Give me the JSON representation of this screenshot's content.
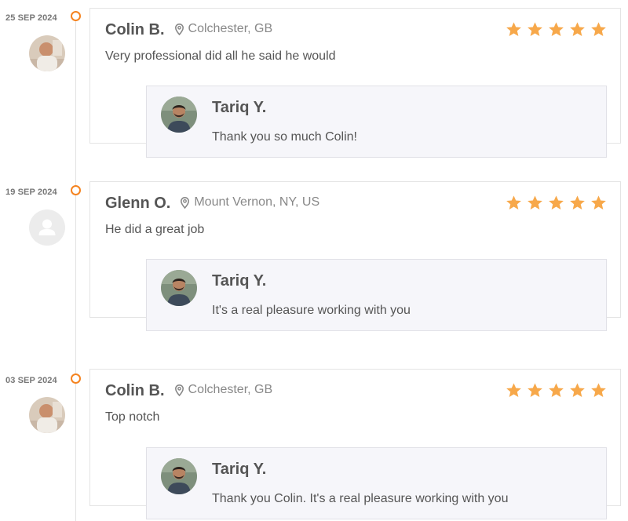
{
  "colors": {
    "accent_orange": "#f5831f",
    "star_color": "#f7a84a",
    "reply_background": "#f6f6fa"
  },
  "reviews": [
    {
      "date": "25 SEP 2024",
      "reviewer_name": "Colin B.",
      "location": "Colchester, GB",
      "rating": 5,
      "text": "Very professional did all he said he would",
      "avatar": "reviewer-photo",
      "reply": {
        "name": "Tariq Y.",
        "text": "Thank you so much Colin!"
      }
    },
    {
      "date": "19 SEP 2024",
      "reviewer_name": "Glenn O.",
      "location": "Mount Vernon, NY, US",
      "rating": 5,
      "text": "He did a great job",
      "avatar": "default-user-icon",
      "reply": {
        "name": "Tariq Y.",
        "text": "It's a real pleasure working with you"
      }
    },
    {
      "date": "03 SEP 2024",
      "reviewer_name": "Colin B.",
      "location": "Colchester, GB",
      "rating": 5,
      "text": "Top notch",
      "avatar": "reviewer-photo",
      "reply": {
        "name": "Tariq Y.",
        "text": "Thank you Colin. It's a real pleasure working with you"
      }
    }
  ]
}
